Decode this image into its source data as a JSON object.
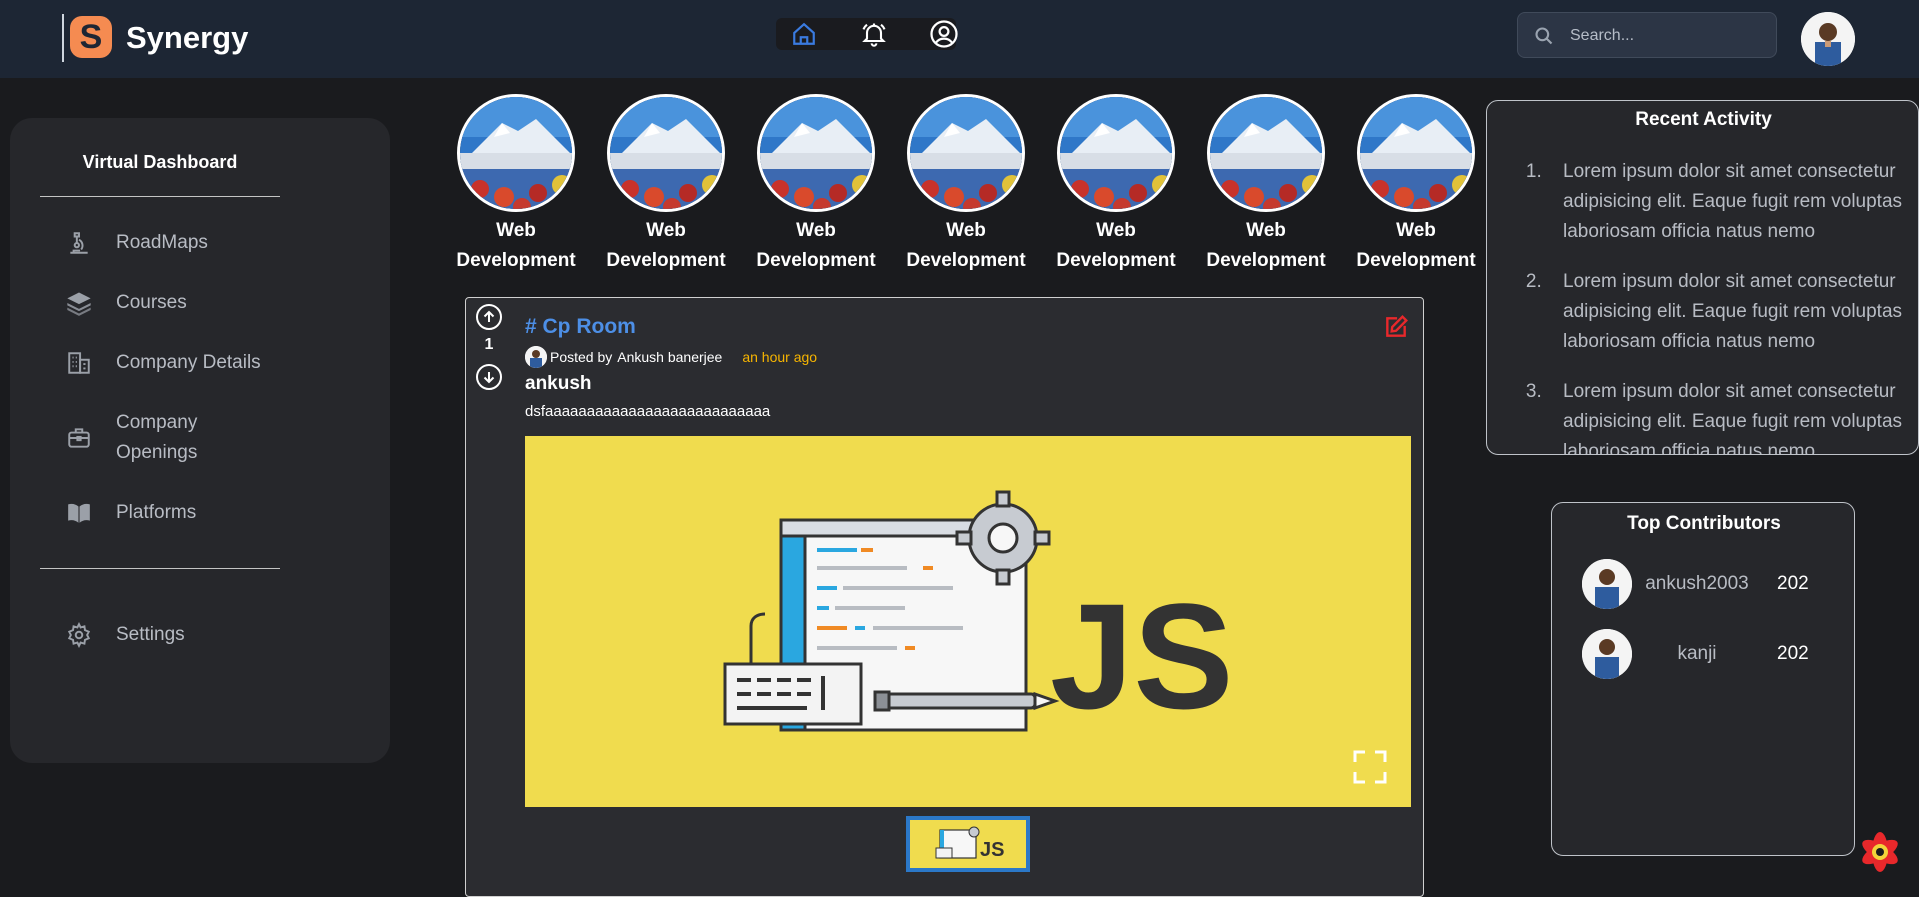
{
  "header": {
    "brand": "Synergy",
    "logo_letter": "S",
    "nav_icons": [
      "home-icon",
      "bell-icon",
      "user-circle-icon"
    ],
    "search_placeholder": "Search..."
  },
  "sidebar": {
    "title": "Virtual Dashboard",
    "items": [
      {
        "label": "RoadMaps",
        "icon": "microscope-icon"
      },
      {
        "label": "Courses",
        "icon": "stack-icon"
      },
      {
        "label": "Company Details",
        "icon": "building-icon"
      },
      {
        "label": "Company Openings",
        "icon": "briefcase-icon"
      },
      {
        "label": "Platforms",
        "icon": "book-icon"
      }
    ],
    "settings_label": "Settings"
  },
  "stories": [
    {
      "label": "Web Development"
    },
    {
      "label": "Web Development"
    },
    {
      "label": "Web Development"
    },
    {
      "label": "Web Development"
    },
    {
      "label": "Web Development"
    },
    {
      "label": "Web Development"
    },
    {
      "label": "Web Development"
    }
  ],
  "post": {
    "votes": "1",
    "room": "# Cp Room",
    "posted_by_prefix": "Posted by",
    "author": "Ankush banerjee",
    "time": "an hour ago",
    "title": "ankush",
    "body": "dsfaaaaaaaaaaaaaaaaaaaaaaaaaaa",
    "image_text": "JS"
  },
  "recent_activity": {
    "title": "Recent Activity",
    "items": [
      "Lorem ipsum dolor sit amet consectetur adipisicing elit. Eaque fugit rem voluptas laboriosam officia natus nemo",
      "Lorem ipsum dolor sit amet consectetur adipisicing elit. Eaque fugit rem voluptas laboriosam officia natus nemo",
      "Lorem ipsum dolor sit amet consectetur adipisicing elit. Eaque fugit rem voluptas laboriosam officia natus nemo"
    ]
  },
  "top_contributors": {
    "title": "Top Contributors",
    "rows": [
      {
        "name": "ankush2003",
        "score": "202"
      },
      {
        "name": "kanji",
        "score": "202"
      }
    ]
  },
  "colors": {
    "header_bg": "#1d2634",
    "page_bg": "#1a1b1e",
    "panel_bg": "#26272b",
    "accent_orange": "#f58b51",
    "link_blue": "#4d8fe6",
    "time_yellow": "#f7b500",
    "edit_red": "#e8282b",
    "js_yellow": "#f0dc4e"
  }
}
